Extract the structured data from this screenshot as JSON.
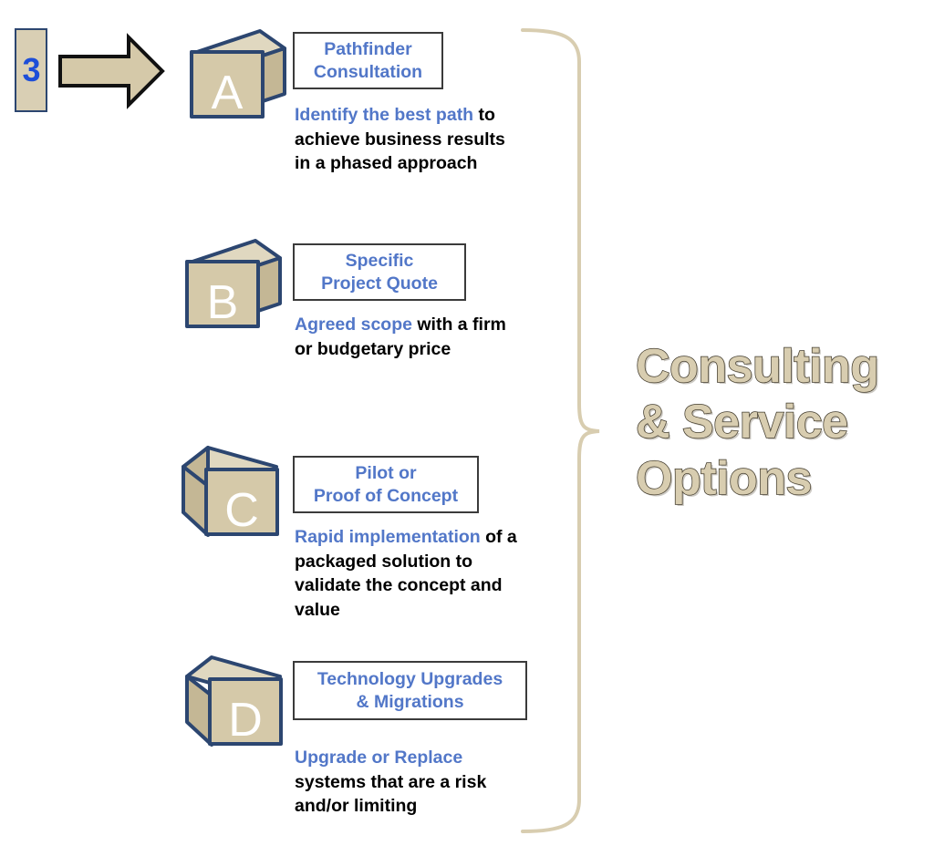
{
  "step": {
    "number": "3",
    "arrow_icon": "right-block-arrow-icon"
  },
  "heading": {
    "text": "Consulting\n& Service\nOptions",
    "fill_color": "#d8cdb0",
    "outline_color": "#403a2c"
  },
  "colors": {
    "accent_blue": "#5277c8",
    "number_blue": "#1d4ed8",
    "cube_front": "#d5c9a9",
    "cube_top": "#e0d8c0",
    "cube_side": "#bfb293",
    "cube_outline": "#2c4670",
    "brace": "#d8cdb0",
    "box_border": "#3b3b3b"
  },
  "items": [
    {
      "letter": "A",
      "cube_facing": "right",
      "title": "Pathfinder\nConsultation",
      "desc_lead": "Identify the best path",
      "desc_rest": " to achieve business results in a phased approach"
    },
    {
      "letter": "B",
      "cube_facing": "right",
      "title": "Specific\nProject Quote",
      "desc_lead": "Agreed scope",
      "desc_rest": " with a firm or budgetary price"
    },
    {
      "letter": "C",
      "cube_facing": "left",
      "title": "Pilot or\nProof of Concept",
      "desc_lead": "Rapid implementation",
      "desc_rest": " of a packaged solution to validate the concept and value"
    },
    {
      "letter": "D",
      "cube_facing": "left",
      "title": "Technology Upgrades\n& Migrations",
      "desc_lead": "Upgrade or Replace",
      "desc_rest": " systems that are a risk and/or limiting"
    }
  ]
}
